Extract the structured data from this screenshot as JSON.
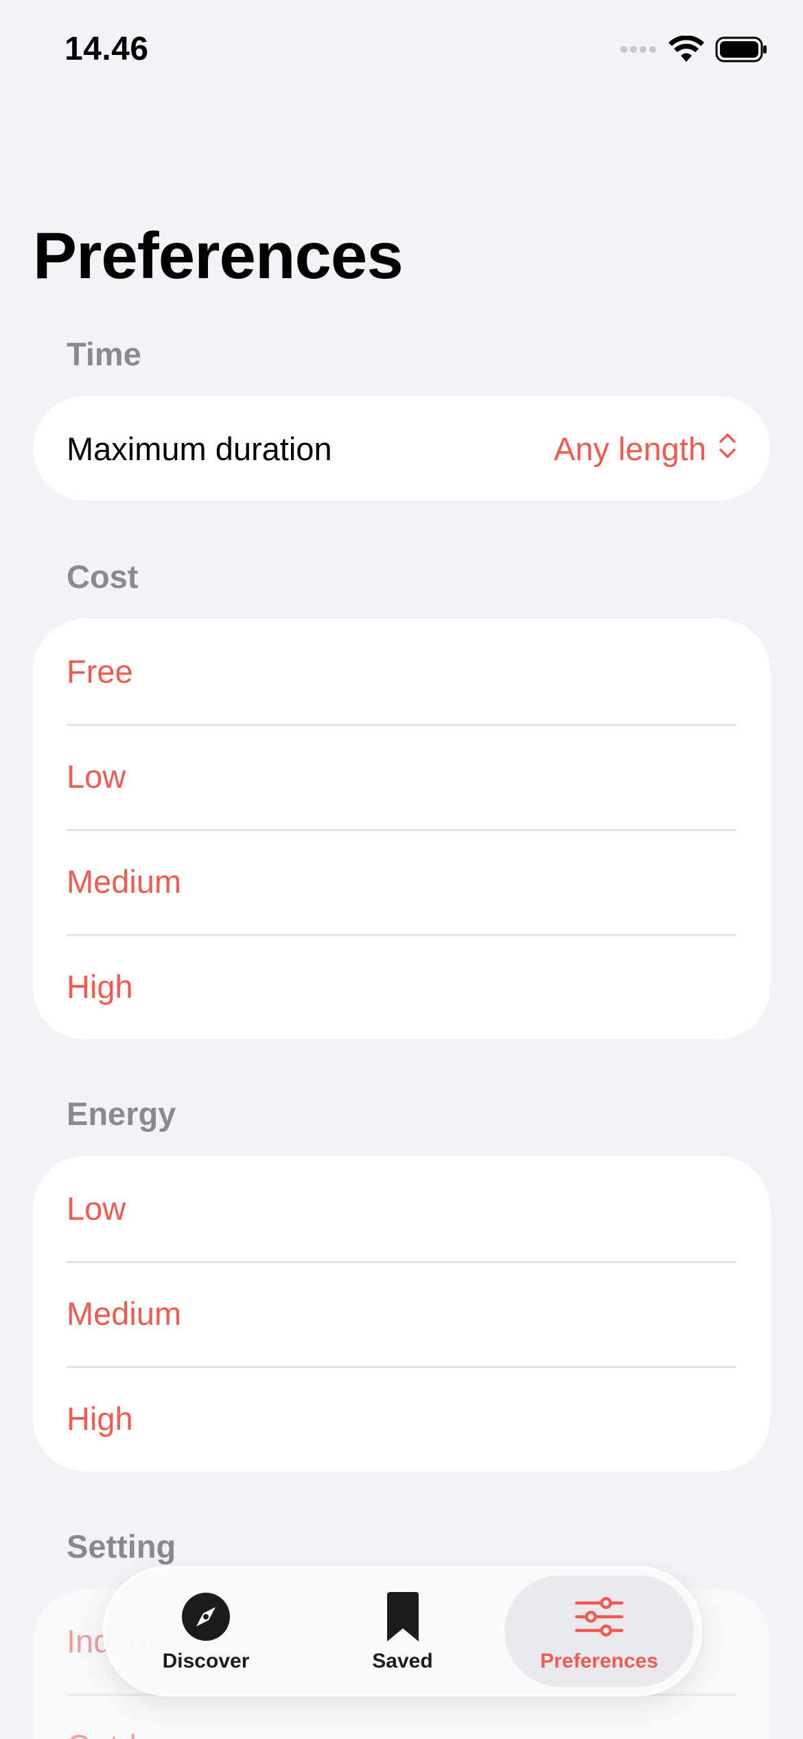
{
  "status_bar": {
    "time": "14.46"
  },
  "title": "Preferences",
  "sections": {
    "time": {
      "header": "Time",
      "row_label": "Maximum duration",
      "row_value": "Any length"
    },
    "cost": {
      "header": "Cost",
      "options": [
        "Free",
        "Low",
        "Medium",
        "High"
      ]
    },
    "energy": {
      "header": "Energy",
      "options": [
        "Low",
        "Medium",
        "High"
      ]
    },
    "setting": {
      "header": "Setting",
      "options": [
        "Indoor",
        "Outdoor"
      ]
    }
  },
  "tab_bar": {
    "tabs": [
      {
        "label": "Discover",
        "icon": "compass-icon"
      },
      {
        "label": "Saved",
        "icon": "bookmark-icon"
      },
      {
        "label": "Preferences",
        "icon": "sliders-icon"
      }
    ],
    "selected": "Preferences"
  },
  "colors": {
    "accent": "#f05a4f",
    "background": "#f2f2f7",
    "card": "#ffffff",
    "secondary_text": "#8a8a8e"
  }
}
